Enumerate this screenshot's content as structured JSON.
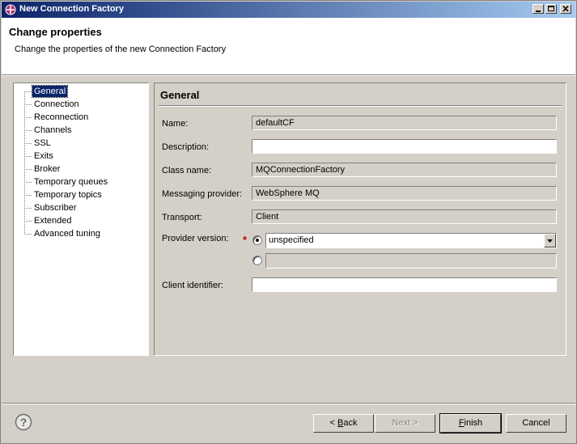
{
  "window": {
    "title": "New Connection Factory",
    "controls": [
      "_",
      "□",
      "×"
    ]
  },
  "header": {
    "title": "Change properties",
    "description": "Change the properties of the new Connection Factory"
  },
  "tree": {
    "items": [
      {
        "label": "General",
        "selected": true
      },
      {
        "label": "Connection"
      },
      {
        "label": "Reconnection"
      },
      {
        "label": "Channels"
      },
      {
        "label": "SSL"
      },
      {
        "label": "Exits"
      },
      {
        "label": "Broker"
      },
      {
        "label": "Temporary queues"
      },
      {
        "label": "Temporary topics"
      },
      {
        "label": "Subscriber"
      },
      {
        "label": "Extended"
      },
      {
        "label": "Advanced tuning"
      }
    ]
  },
  "panel": {
    "title": "General",
    "fields": {
      "name": {
        "label": "Name:",
        "value": "defaultCF"
      },
      "description": {
        "label": "Description:",
        "value": ""
      },
      "class_name": {
        "label": "Class name:",
        "value": "MQConnectionFactory"
      },
      "messaging_provider": {
        "label": "Messaging provider:",
        "value": "WebSphere MQ"
      },
      "transport": {
        "label": "Transport:",
        "value": "Client"
      },
      "provider_version": {
        "label": "Provider version:",
        "required_marker": "*",
        "combo_value": "unspecified",
        "text_value": "",
        "selected_option": "combo"
      },
      "client_identifier": {
        "label": "Client identifier:",
        "value": ""
      }
    }
  },
  "footer": {
    "help_icon": "help-icon",
    "back": "< Back",
    "next": "Next >",
    "finish": "Finish",
    "cancel": "Cancel"
  },
  "colors": {
    "title_gradient_start": "#0a246a",
    "title_gradient_end": "#a6caf0",
    "selection": "#0a246a",
    "dialog_bg": "#d4d0c8",
    "required": "#c00000"
  }
}
